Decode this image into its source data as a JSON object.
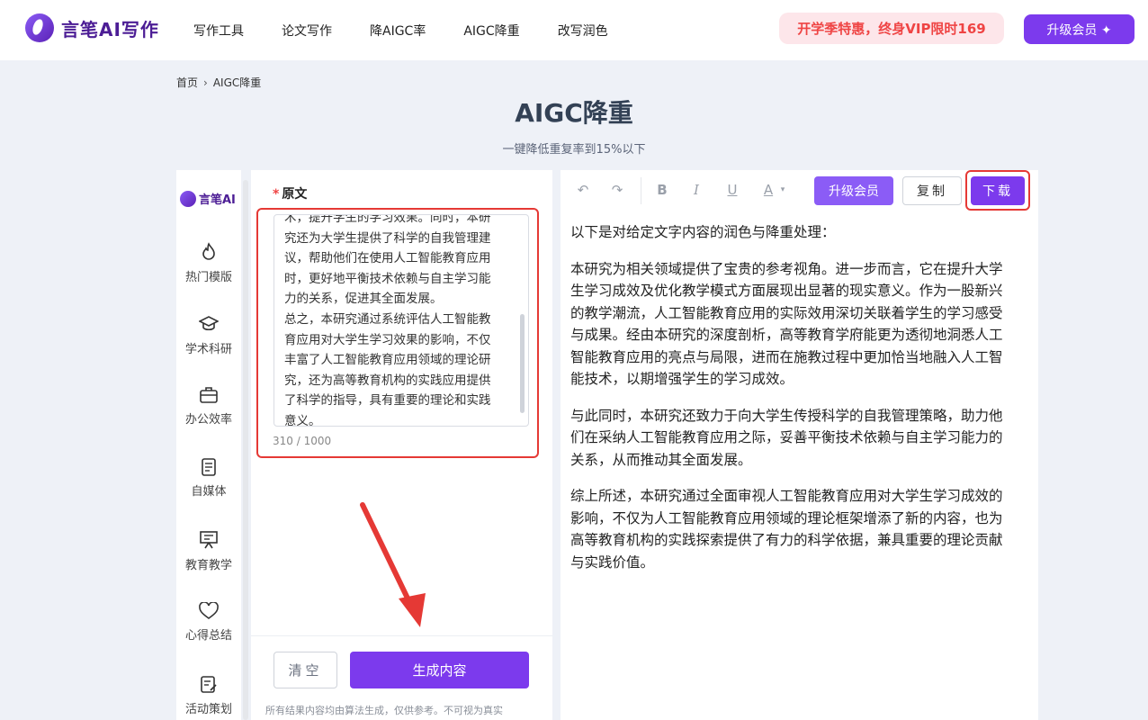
{
  "header": {
    "logo_text": "言笔AI写作",
    "nav": [
      "写作工具",
      "论文写作",
      "降AIGC率",
      "AIGC降重",
      "改写润色"
    ],
    "promo": "开学季特惠，终身VIP限时169",
    "upgrade": "升级会员 ✦"
  },
  "breadcrumb": {
    "home": "首页",
    "sep": "›",
    "current": "AIGC降重"
  },
  "page": {
    "title": "AIGC降重",
    "subtitle": "一键降低重复率到15%以下"
  },
  "sidebar": {
    "logo_text": "言笔AI",
    "items": [
      {
        "label": "热门模版",
        "icon": "flame-icon"
      },
      {
        "label": "学术科研",
        "icon": "graduation-cap-icon"
      },
      {
        "label": "办公效率",
        "icon": "briefcase-icon"
      },
      {
        "label": "自媒体",
        "icon": "document-icon"
      },
      {
        "label": "教育教学",
        "icon": "presentation-board-icon"
      },
      {
        "label": "心得总结",
        "icon": "heart-icon"
      },
      {
        "label": "活动策划",
        "icon": "clipboard-edit-icon"
      }
    ]
  },
  "input": {
    "label": "原文",
    "required_mark": "*",
    "lines": [
      "术，提升学生的学习效果。同时，本研",
      "究还为大学生提供了科学的自我管理建",
      "议，帮助他们在使用人工智能教育应用",
      "时，更好地平衡技术依赖与自主学习能",
      "力的关系，促进其全面发展。",
      "总之，本研究通过系统评估人工智能教",
      "育应用对大学生学习效果的影响，不仅",
      "丰富了人工智能教育应用领域的理论研",
      "究，还为高等教育机构的实践应用提供",
      "了科学的指导，具有重要的理论和实践",
      "意义。"
    ],
    "counter": "310 / 1000"
  },
  "actions": {
    "clear": "清空",
    "generate": "生成内容",
    "disclaimer": "所有结果内容均由算法生成，仅供参考。不可视为真实"
  },
  "editor": {
    "toolbar": {
      "undo": "↶",
      "redo": "↷",
      "bold": "B",
      "italic": "I",
      "underline": "U",
      "color": "A",
      "upgrade": "升级会员",
      "copy": "复制",
      "download": "下载"
    },
    "paragraphs": [
      "以下是对给定文字内容的润色与降重处理：",
      "本研究为相关领域提供了宝贵的参考视角。进一步而言，它在提升大学生学习成效及优化教学模式方面展现出显著的现实意义。作为一股新兴的教学潮流，人工智能教育应用的实际效用深切关联着学生的学习感受与成果。经由本研究的深度剖析，高等教育学府能更为透彻地洞悉人工智能教育应用的亮点与局限，进而在施教过程中更加恰当地融入人工智能技术，以期增强学生的学习成效。",
      "与此同时，本研究还致力于向大学生传授科学的自我管理策略，助力他们在采纳人工智能教育应用之际，妥善平衡技术依赖与自主学习能力的关系，从而推动其全面发展。",
      "综上所述，本研究通过全面审视人工智能教育应用对大学生学习成效的影响，不仅为人工智能教育应用领域的理论框架增添了新的内容，也为高等教育机构的实践探索提供了有力的科学依据，兼具重要的理论贡献与实践价值。"
    ]
  },
  "colors": {
    "accent": "#7c3aed",
    "highlight": "#e53935",
    "promo_text": "#ef4444"
  }
}
